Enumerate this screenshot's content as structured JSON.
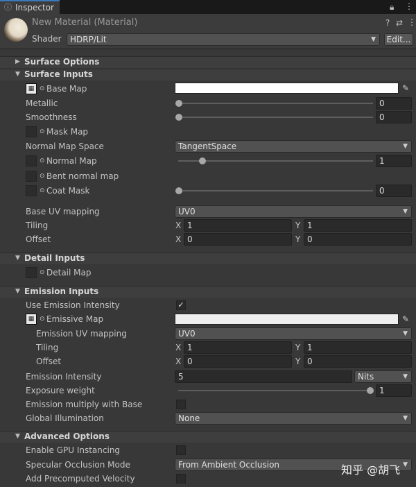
{
  "tab": {
    "label": "Inspector",
    "icon": "info-icon"
  },
  "tab_tools": [
    "lock-icon",
    "menu-icon"
  ],
  "header": {
    "title": "New Material (Material)",
    "icons": [
      "help-icon",
      "preset-icon",
      "more-icon"
    ],
    "shader_label": "Shader",
    "shader_value": "HDRP/Lit",
    "edit_label": "Edit..."
  },
  "sections": {
    "surface_options": "Surface Options",
    "surface_inputs": "Surface Inputs",
    "detail_inputs": "Detail Inputs",
    "emission_inputs": "Emission Inputs",
    "advanced_options": "Advanced Options"
  },
  "surface_inputs": {
    "base_map": "Base Map",
    "metallic": {
      "label": "Metallic",
      "value": "0",
      "fraction": 0
    },
    "smoothness": {
      "label": "Smoothness",
      "value": "0",
      "fraction": 0
    },
    "mask_map": "Mask Map",
    "normal_map_space": {
      "label": "Normal Map Space",
      "value": "TangentSpace"
    },
    "normal_map": {
      "label": "Normal Map",
      "value": "1",
      "fraction": 0.125
    },
    "bent_normal_map": "Bent normal map",
    "coat_mask": {
      "label": "Coat Mask",
      "value": "0",
      "fraction": 0
    },
    "base_uv": {
      "label": "Base UV mapping",
      "value": "UV0"
    },
    "tiling": {
      "label": "Tiling",
      "x_label": "X",
      "x": "1",
      "y_label": "Y",
      "y": "1"
    },
    "offset": {
      "label": "Offset",
      "x_label": "X",
      "x": "0",
      "y_label": "Y",
      "y": "0"
    }
  },
  "detail_inputs": {
    "detail_map": "Detail Map"
  },
  "emission_inputs": {
    "use_intensity": {
      "label": "Use Emission Intensity",
      "checked": true
    },
    "emissive_map": "Emissive Map",
    "uv_mapping": {
      "label": "Emission UV mapping",
      "value": "UV0"
    },
    "tiling": {
      "label": "Tiling",
      "x_label": "X",
      "x": "1",
      "y_label": "Y",
      "y": "1"
    },
    "offset": {
      "label": "Offset",
      "x_label": "X",
      "x": "0",
      "y_label": "Y",
      "y": "0"
    },
    "intensity": {
      "label": "Emission Intensity",
      "value": "5",
      "unit": "Nits"
    },
    "exposure": {
      "label": "Exposure weight",
      "value": "1",
      "fraction": 1
    },
    "multiply_base": {
      "label": "Emission multiply with Base",
      "checked": false
    },
    "global_illum": {
      "label": "Global Illumination",
      "value": "None"
    }
  },
  "advanced": {
    "gpu_instancing": {
      "label": "Enable GPU Instancing",
      "checked": false
    },
    "specular_occlusion": {
      "label": "Specular Occlusion Mode",
      "value": "From Ambient Occlusion"
    },
    "precomputed_velocity": {
      "label": "Add Precomputed Velocity",
      "checked": false
    }
  },
  "watermark": "知乎 @胡飞",
  "colors": {
    "accent": "#3a79bb",
    "panel": "#383838",
    "header": "#3c3c3c"
  }
}
